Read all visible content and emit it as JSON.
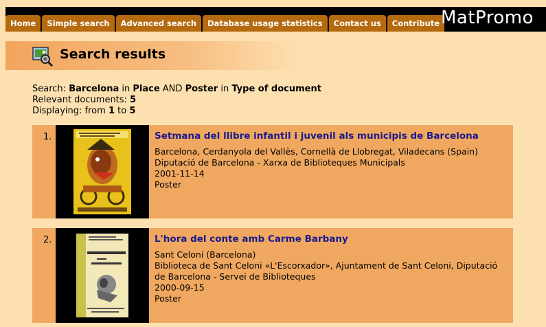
{
  "nav": {
    "tabs": [
      "Home",
      "Simple search",
      "Advanced search",
      "Database usage statistics",
      "Contact us",
      "Contribute"
    ]
  },
  "brand": "MatPromo",
  "page_title": "Search results",
  "summary": {
    "search_label": "Search:",
    "term1": "Barcelona",
    "in1": "in",
    "field1": "Place",
    "op": "AND",
    "term2": "Poster",
    "in2": "in",
    "field2": "Type of document",
    "relevant_label": "Relevant documents:",
    "relevant_count": "5",
    "displaying_label": "Displaying: from",
    "from": "1",
    "to_label": "to",
    "to": "5"
  },
  "results": [
    {
      "num": "1.",
      "title": "Setmana del llibre infantil i juvenil als municipis de Barcelona",
      "place": "Barcelona, Cerdanyola del Vallès, Cornellà de Llobregat, Viladecans (Spain)",
      "org": "Diputació de Barcelona - Xarxa de Biblioteques Municipals",
      "date": "2001-11-14",
      "type": "Poster"
    },
    {
      "num": "2.",
      "title": "L'hora del conte amb Carme Barbany",
      "place": "Sant Celoni (Barcelona)",
      "org": "Biblioteca de Sant Celoni «L'Escorxador», Ajuntament de Sant Celoni, Diputació de Barcelona - Servei de Biblioteques",
      "date": "2000-09-15",
      "type": "Poster"
    }
  ],
  "colors": {
    "background": "#fde0b0",
    "tab": "#b56a10",
    "result_bg": "#f0a860",
    "link": "#1a1a8c"
  }
}
